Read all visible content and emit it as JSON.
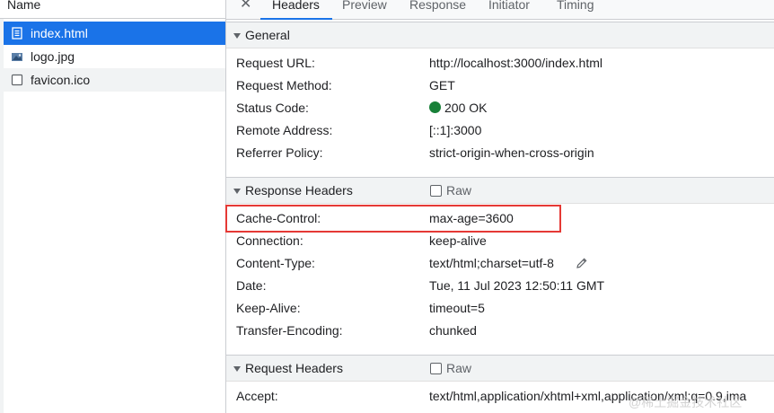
{
  "file_list": {
    "header": "Name",
    "items": [
      {
        "name": "index.html",
        "icon": "document-icon",
        "selected": true
      },
      {
        "name": "logo.jpg",
        "icon": "image-icon",
        "selected": false
      },
      {
        "name": "favicon.ico",
        "icon": "blank-file-icon",
        "selected": false
      }
    ]
  },
  "tabs": [
    {
      "label": "Headers",
      "active": true
    },
    {
      "label": "Preview",
      "active": false
    },
    {
      "label": "Response",
      "active": false
    },
    {
      "label": "Initiator",
      "active": false
    },
    {
      "label": "Timing",
      "active": false
    }
  ],
  "general": {
    "title": "General",
    "rows": [
      {
        "key": "Request URL:",
        "value": "http://localhost:3000/index.html"
      },
      {
        "key": "Request Method:",
        "value": "GET"
      },
      {
        "key": "Status Code:",
        "value": "200 OK"
      },
      {
        "key": "Remote Address:",
        "value": "[::1]:3000"
      },
      {
        "key": "Referrer Policy:",
        "value": "strict-origin-when-cross-origin"
      }
    ]
  },
  "response_headers": {
    "title": "Response Headers",
    "raw_label": "Raw",
    "rows": [
      {
        "key": "Cache-Control:",
        "value": "max-age=3600"
      },
      {
        "key": "Connection:",
        "value": "keep-alive"
      },
      {
        "key": "Content-Type:",
        "value": "text/html;charset=utf-8"
      },
      {
        "key": "Date:",
        "value": "Tue, 11 Jul 2023 12:50:11 GMT"
      },
      {
        "key": "Keep-Alive:",
        "value": "timeout=5"
      },
      {
        "key": "Transfer-Encoding:",
        "value": "chunked"
      }
    ]
  },
  "request_headers": {
    "title": "Request Headers",
    "raw_label": "Raw",
    "rows": [
      {
        "key": "Accept:",
        "value": "text/html,application/xhtml+xml,application/xml;q=0.9,ima"
      }
    ]
  },
  "watermark": "@稀土掘金技术社区",
  "colors": {
    "accent": "#1a73e8",
    "status_ok": "#188038",
    "highlight": "#e53935"
  }
}
